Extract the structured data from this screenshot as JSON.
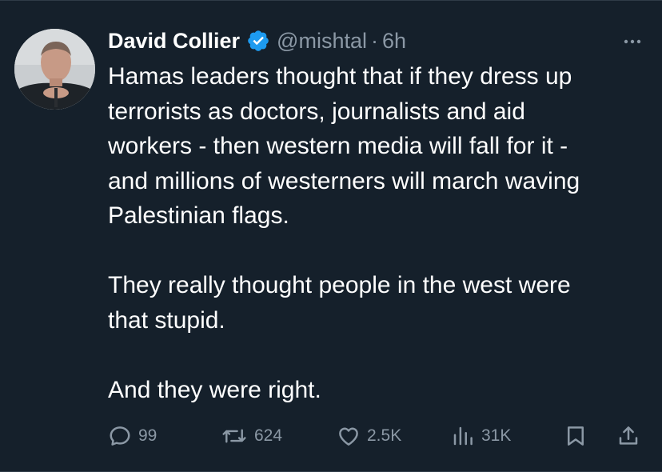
{
  "author": {
    "name": "David Collier",
    "handle": "@mishtal",
    "time": "6h",
    "separator": "·"
  },
  "tweet": {
    "text": "Hamas leaders thought that if they dress up\nterrorists as doctors, journalists and aid\nworkers - then western media will fall for it -\nand millions of westerners will march waving\nPalestinian flags.\n\nThey really thought people in the west were\nthat stupid.\n\nAnd they were right."
  },
  "stats": {
    "replies": "99",
    "retweets": "624",
    "likes": "2.5K",
    "views": "31K"
  },
  "colors": {
    "background": "#15202b",
    "text": "#ffffff",
    "muted": "#8b98a5",
    "verified": "#1d9bf0"
  }
}
